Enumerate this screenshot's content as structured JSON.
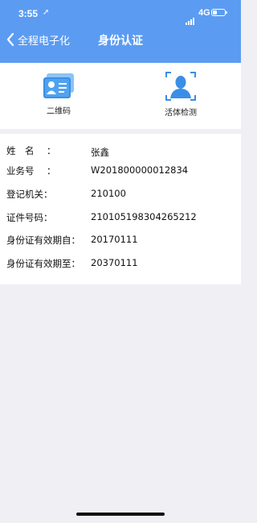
{
  "status_bar": {
    "time": "3:55",
    "network": "4G"
  },
  "nav": {
    "back_label": "全程电子化",
    "title": "身份认证"
  },
  "actions": [
    {
      "label": "二维码",
      "icon": "qr-code-card-icon"
    },
    {
      "label": "活体检测",
      "icon": "face-scan-icon"
    }
  ],
  "info": {
    "name_key": "姓　名",
    "name_value": "张鑫",
    "biz_key": "业务号",
    "biz_value": "W201800000012834",
    "reg_key": "登记机关：",
    "reg_value": "210100",
    "id_key": "证件号码：",
    "id_value": "210105198304265212",
    "start_key": "身份证有效期自：",
    "start_value": "20170111",
    "end_key": "身份证有效期至：",
    "end_value": "20370111"
  },
  "colors": {
    "header": "#5b9cf2",
    "background": "#efeff4"
  }
}
